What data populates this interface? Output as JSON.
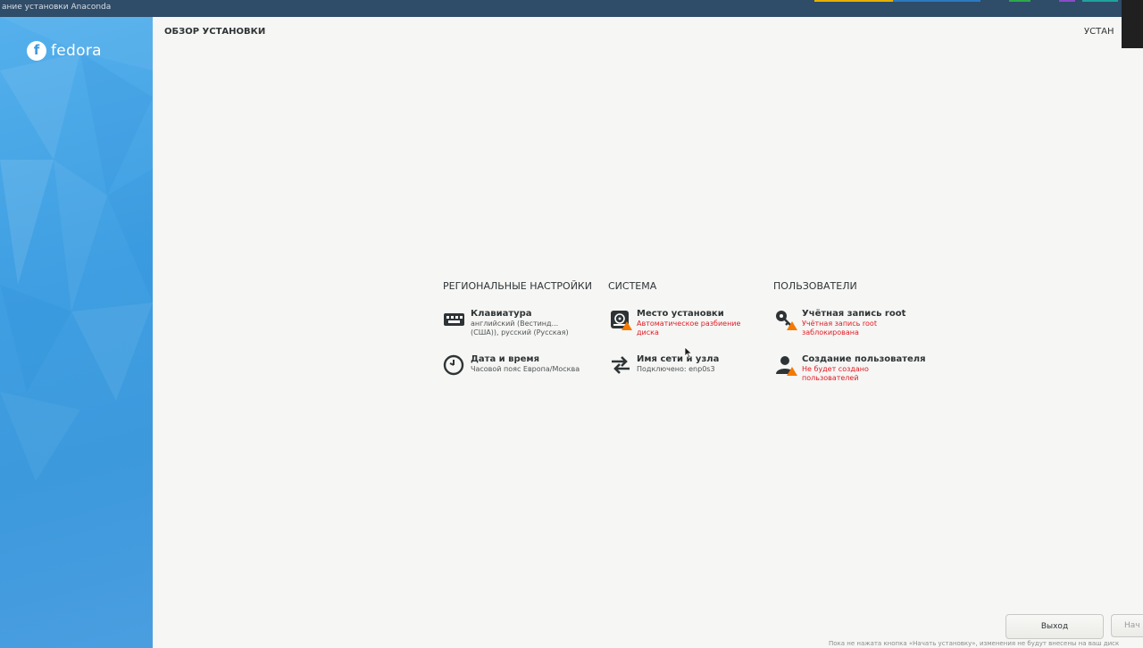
{
  "window": {
    "title": "ание установки Anaconda"
  },
  "brand": {
    "logo_text": "fedora",
    "logo_glyph": "f",
    "sidebar_color": "#3d9be0"
  },
  "header": {
    "page_title": "ОБЗОР УСТАНОВКИ",
    "product": "УСТАН"
  },
  "categories": [
    {
      "title": "РЕГИОНАЛЬНЫЕ НАСТРОЙКИ",
      "spokes": [
        {
          "name": "Клавиатура",
          "status": [
            "английский (Вестинд...",
            "(США)), русский (Русская)"
          ],
          "icon": "keyboard-icon",
          "warning": false
        },
        {
          "name": "Дата и время",
          "status": [
            "Часовой пояс Европа/Москва"
          ],
          "icon": "clock-icon",
          "warning": false
        }
      ]
    },
    {
      "title": "СИСТЕМА",
      "spokes": [
        {
          "name": "Место установки",
          "status": [
            "Автоматическое разбиение",
            "диска"
          ],
          "icon": "disk-icon",
          "warning": true
        },
        {
          "name": "Имя сети и узла",
          "status": [
            "Подключено: enp0s3"
          ],
          "icon": "network-icon",
          "warning": false
        }
      ]
    },
    {
      "title": "ПОЛЬЗОВАТЕЛИ",
      "spokes": [
        {
          "name": "Учётная запись root",
          "status": [
            "Учётная запись root",
            "заблокирована"
          ],
          "icon": "root-key-icon",
          "warning": true
        },
        {
          "name": "Создание пользователя",
          "status": [
            "Не будет создано",
            "пользователей"
          ],
          "icon": "user-icon",
          "warning": true
        }
      ]
    }
  ],
  "footer": {
    "quit_label": "Выход",
    "begin_label": "Нач",
    "note": "Пока не нажата кнопка «Начать установку», изменения не будут внесены на ваш диск"
  },
  "colors": {
    "warning_text": "#e01b24",
    "warning_badge": "#f57900",
    "titlebar": "#2f4c68"
  }
}
